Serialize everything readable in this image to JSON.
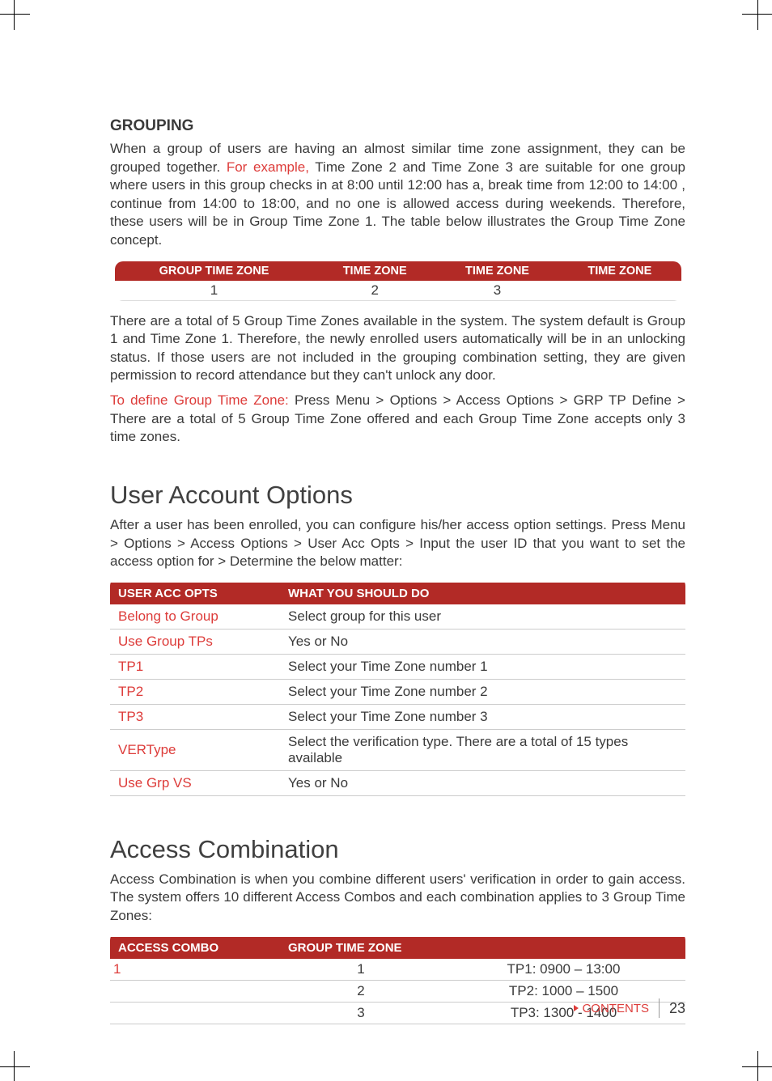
{
  "accent_color": "#b22a26",
  "link_color": "#dd3c3a",
  "grouping": {
    "heading": "GROUPING",
    "para1_pre": "When a group of users are having an almost similar time zone assignment, they can be grouped together. ",
    "para1_ex": "For example,",
    "para1_post": " Time Zone 2 and Time Zone 3 are suitable for one group where users in this group checks in at 8:00 until 12:00 has a, break time from 12:00 to 14:00 , continue from 14:00 to 18:00, and no one is allowed access during weekends. Therefore, these users will be in Group Time Zone 1. The table below illustrates the Group Time Zone concept.",
    "table": {
      "h1": "GROUP TIME ZONE",
      "h2": "TIME ZONE",
      "h3": "TIME ZONE",
      "h4": "TIME ZONE",
      "r1c1": "1",
      "r1c2": "2",
      "r1c3": "3",
      "r1c4": ""
    },
    "para2": "There are a total of 5 Group Time Zones available in the system. The system default is Group 1 and Time Zone 1. Therefore, the newly enrolled users automatically will be in an unlocking status. If those users are not included in the grouping combination setting, they are given permission to record attendance but they can't unlock any door.",
    "para3_lead": "To define Group Time Zone:",
    "para3_rest": " Press Menu > Options > Access Options > GRP TP Define > There are a total of 5 Group Time Zone offered and each Group Time Zone accepts only 3 time zones."
  },
  "useropts": {
    "heading": "User Account Options",
    "intro": "After a user has been enrolled, you can configure his/her access option settings. Press Menu > Options > Access Options > User Acc Opts > Input the user ID that you want to set the access option for > Determine the below matter:",
    "h1": "USER ACC OPTS",
    "h2": "WHAT YOU SHOULD DO",
    "rows": {
      "r0k": "Belong to Group",
      "r0v": "Select group for this user",
      "r1k": "Use Group TPs",
      "r1v": "Yes or No",
      "r2k": "TP1",
      "r2v": "Select your Time Zone number 1",
      "r3k": "TP2",
      "r3v": "Select your Time Zone number 2",
      "r4k": "TP3",
      "r4v": "Select your Time Zone number 3",
      "r5k": "VERType",
      "r5v": "Select the verification type. There are a total of 15 types available",
      "r6k": "Use Grp VS",
      "r6v": "Yes or No"
    }
  },
  "combo": {
    "heading": "Access Combination",
    "intro": "Access Combination is when you combine different users' verification in order to gain access. The system offers 10 different Access Combos and each combination applies to 3 Group Time Zones:",
    "h1": "ACCESS COMBO",
    "h2": "GROUP TIME ZONE",
    "rows": {
      "r0a": "1",
      "r0b": "1",
      "r0c": "TP1: 0900 – 13:00",
      "r1a": "",
      "r1b": "2",
      "r1c": "TP2: 1000 – 1500",
      "r2a": "",
      "r2b": "3",
      "r2c": "TP3: 1300 - 1400"
    }
  },
  "footer": {
    "contents": "CONTENTS",
    "page": "23"
  }
}
